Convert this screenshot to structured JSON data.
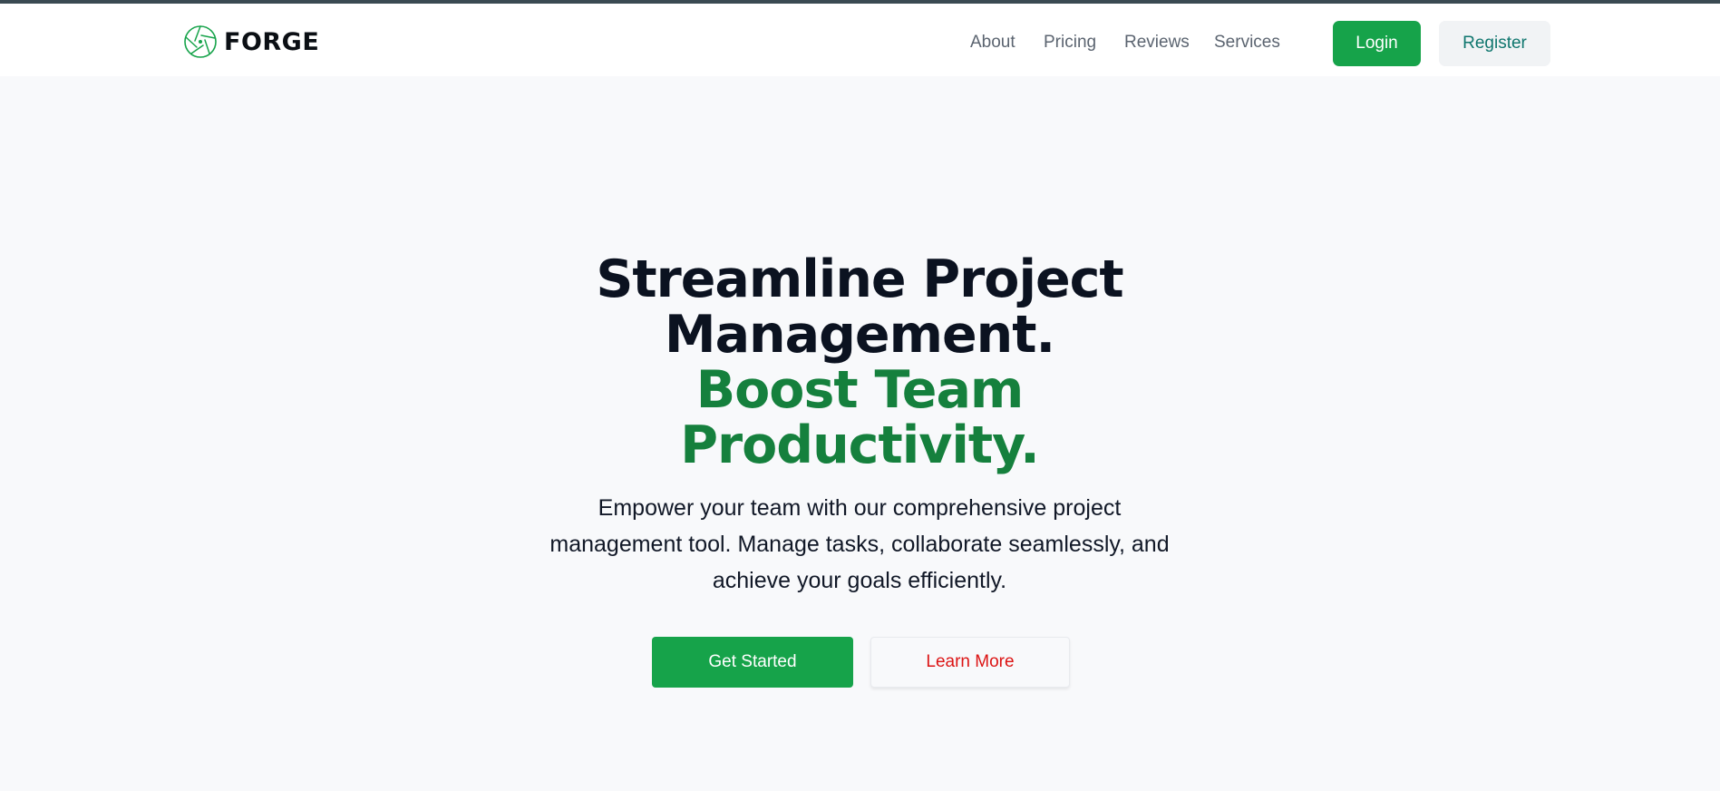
{
  "brand": {
    "name": "FORGE",
    "icon": "aperture-logo-icon",
    "accent_color": "#16a34a"
  },
  "nav": {
    "items": [
      {
        "label": "About"
      },
      {
        "label": "Pricing"
      },
      {
        "label": "Reviews"
      },
      {
        "label": "Services"
      }
    ],
    "login_label": "Login",
    "register_label": "Register"
  },
  "hero": {
    "headline_dark": [
      "Streamline Project",
      "Management."
    ],
    "headline_green": [
      "Boost Team",
      "Productivity."
    ],
    "description": "Empower your team with our comprehensive project management tool. Manage tasks, collaborate seamlessly, and achieve your goals efficiently.",
    "primary_cta": "Get Started",
    "secondary_cta": "Learn More"
  },
  "colors": {
    "headline_dark": "#0b1220",
    "headline_green": "#15803d",
    "primary_button": "#16a34a",
    "secondary_button_text": "#dc1414",
    "register_text": "#0f766e"
  }
}
